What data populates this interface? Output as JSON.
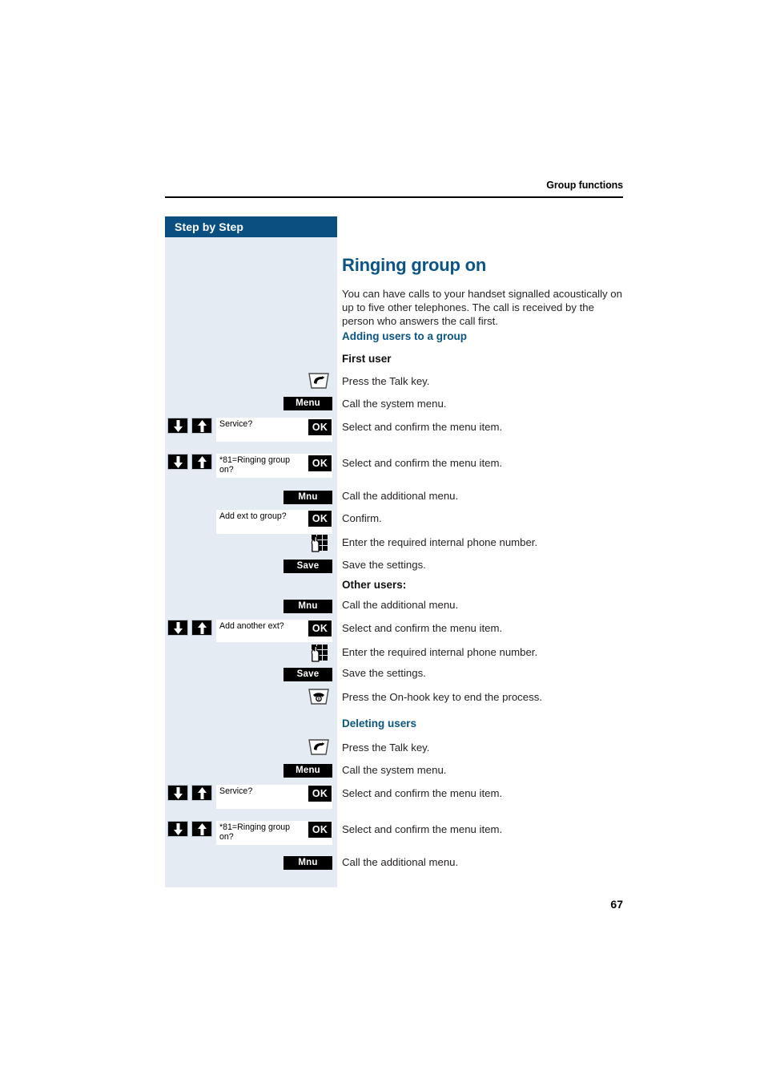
{
  "page": {
    "running_head": "Group functions",
    "folio": "67",
    "colors": {
      "accent_blue": "#0a5585",
      "panel_header_blue": "#0a4f80",
      "panel_body": "#e4ebf2",
      "key_black": "#000000"
    }
  },
  "sidebar": {
    "header_label": "Step by Step"
  },
  "main": {
    "title": "Ringing group on",
    "intro": "You can have calls to your handset signalled acoustically on up to five other telephones. The call is received by the person who answers the call first.",
    "section_adding": "Adding users to a group",
    "subsection_first_user": "First user",
    "subsection_other_users": "Other users:",
    "section_deleting": "Deleting users"
  },
  "steps": [
    {
      "icon": "talk-key-icon",
      "text": "Press the Talk key."
    },
    {
      "softkey": "Menu",
      "text": "Call the system menu."
    },
    {
      "arrows": true,
      "display": "Service?",
      "ok": "OK",
      "text": "Select and confirm the menu item."
    },
    {
      "arrows": true,
      "display": "*81=Ringing group on?",
      "ok": "OK",
      "text": "Select and confirm the menu item."
    },
    {
      "softkey": "Mnu",
      "text": "Call the additional menu."
    },
    {
      "display": "Add ext to group?",
      "ok": "OK",
      "text": "Confirm."
    },
    {
      "icon": "keypad-icon",
      "text": "Enter the required internal phone number."
    },
    {
      "softkey": "Save",
      "text": "Save the settings."
    },
    {
      "softkey": "Mnu",
      "text": "Call the additional menu."
    },
    {
      "arrows": true,
      "display": "Add another ext?",
      "ok": "OK",
      "text": "Select and confirm the menu item."
    },
    {
      "icon": "keypad-icon",
      "text": "Enter the required internal phone number."
    },
    {
      "softkey": "Save",
      "text": "Save the settings."
    },
    {
      "icon": "on-hook-key-icon",
      "text": "Press the On-hook key to end the process."
    },
    {
      "icon": "talk-key-icon",
      "text": "Press the Talk key."
    },
    {
      "softkey": "Menu",
      "text": "Call the system menu."
    },
    {
      "arrows": true,
      "display": "Service?",
      "ok": "OK",
      "text": "Select and confirm the menu item."
    },
    {
      "arrows": true,
      "display": "*81=Ringing group on?",
      "ok": "OK",
      "text": "Select and confirm the menu item."
    },
    {
      "softkey": "Mnu",
      "text": "Call the additional menu."
    }
  ]
}
